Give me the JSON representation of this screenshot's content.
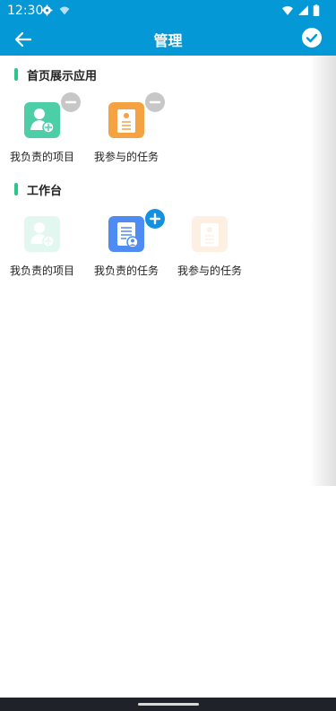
{
  "status": {
    "time": "12:30",
    "icons": [
      "settings-icon",
      "wifi-icon",
      "signal-icon",
      "battery-icon"
    ]
  },
  "header": {
    "title": "管理",
    "back_icon": "arrow-left-icon",
    "confirm_icon": "check-circle-icon"
  },
  "sections": [
    {
      "title": "首页展示应用",
      "apps": [
        {
          "label": "我负责的项目",
          "icon": "project-icon",
          "color": "#4ccfa6",
          "badge": "remove"
        },
        {
          "label": "我参与的任务",
          "icon": "task-participate-icon",
          "color": "#f5a243",
          "badge": "remove"
        }
      ]
    },
    {
      "title": "工作台",
      "apps": [
        {
          "label": "我负责的项目",
          "icon": "project-icon",
          "color": "#4ccfa6",
          "state": "added"
        },
        {
          "label": "我负责的任务",
          "icon": "task-responsible-icon",
          "color": "#4e8cf4",
          "badge": "add"
        },
        {
          "label": "我参与的任务",
          "icon": "task-participate-icon",
          "color": "#f5a243",
          "state": "added"
        }
      ]
    }
  ],
  "colors": {
    "primary": "#0598d6",
    "section_accent": "#2fc58a",
    "remove_badge": "#c7c7c7",
    "add_badge": "#1391e0"
  }
}
